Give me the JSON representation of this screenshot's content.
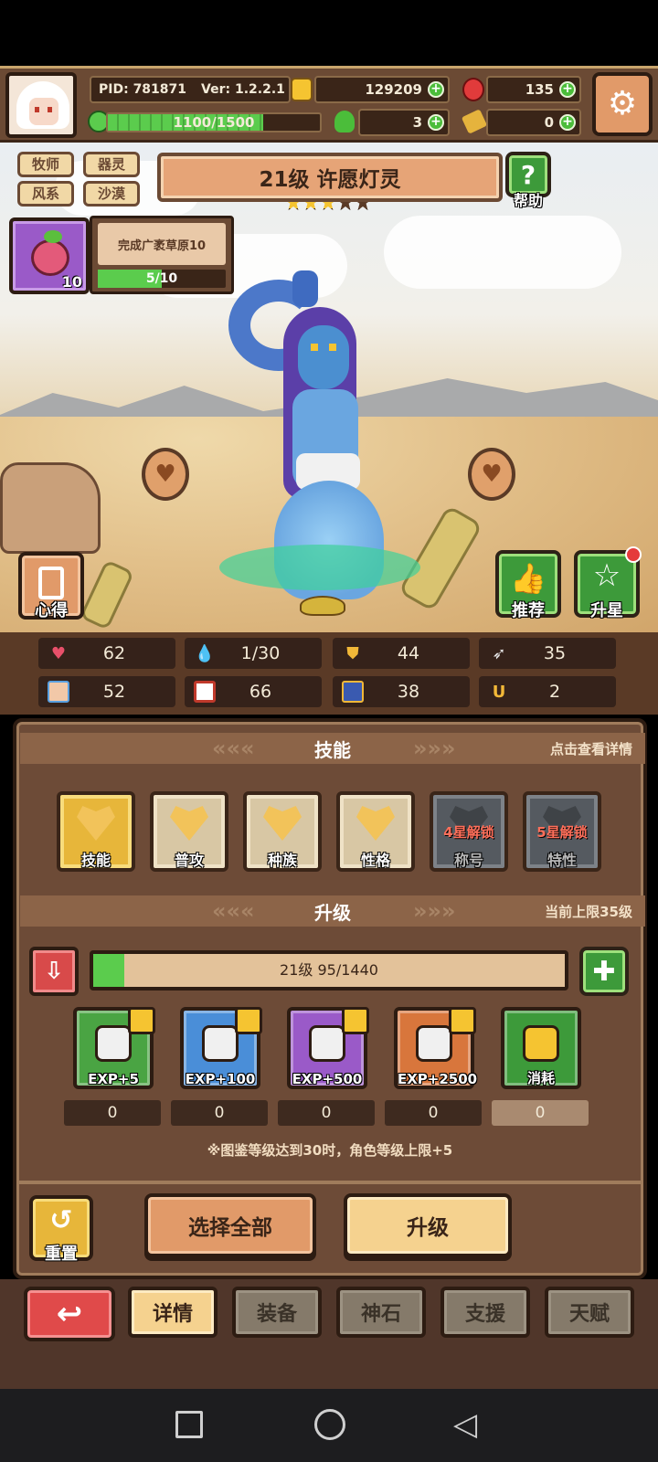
{
  "header": {
    "pid": "PID: 781871",
    "version": "Ver: 1.2.2.1",
    "gold": "129209",
    "gems": "135",
    "clover": "3",
    "tickets": "0",
    "exp_text": "1100/1500",
    "exp_fraction": 0.733
  },
  "character": {
    "class_tags": [
      "牧师",
      "器灵",
      "风系",
      "沙漠"
    ],
    "title": "21级 许愿灯灵",
    "stars_filled": 3,
    "stars_total": 5,
    "help_label": "帮助"
  },
  "quest": {
    "text": "完成广袤草原10",
    "progress": "5/10",
    "progress_fraction": 0.5,
    "item_count": "10"
  },
  "side_buttons": {
    "notes": "心得",
    "recommend": "推荐",
    "star_up": "升星"
  },
  "stats": [
    "62",
    "1/30",
    "44",
    "35",
    "52",
    "66",
    "38",
    "2"
  ],
  "skills_section": {
    "title": "技能",
    "hint": "点击查看详情",
    "items": [
      {
        "label": "技能",
        "state": "active"
      },
      {
        "label": "普攻",
        "state": "normal"
      },
      {
        "label": "种族",
        "state": "normal"
      },
      {
        "label": "性格",
        "state": "normal"
      },
      {
        "label": "称号",
        "state": "locked",
        "lock_text": "4星解锁"
      },
      {
        "label": "特性",
        "state": "locked",
        "lock_text": "5星解锁"
      }
    ]
  },
  "upgrade_section": {
    "title": "升级",
    "limit": "当前上限35级",
    "level_text": "21级  95/1440",
    "level_fraction": 0.066,
    "items": [
      {
        "label": "EXP+5",
        "count": "0",
        "color": "#4aa443"
      },
      {
        "label": "EXP+100",
        "count": "0",
        "color": "#4a8ed8"
      },
      {
        "label": "EXP+500",
        "count": "0",
        "color": "#9a5ac8"
      },
      {
        "label": "EXP+2500",
        "count": "0",
        "color": "#d8763c"
      },
      {
        "label": "消耗",
        "count": "0",
        "color": "#3d9a3a"
      }
    ],
    "note": "※图鉴等级达到30时，角色等级上限+5"
  },
  "actions": {
    "reset": "重置",
    "select_all": "选择全部",
    "upgrade": "升级"
  },
  "tabs": [
    "详情",
    "装备",
    "神石",
    "支援",
    "天赋"
  ]
}
